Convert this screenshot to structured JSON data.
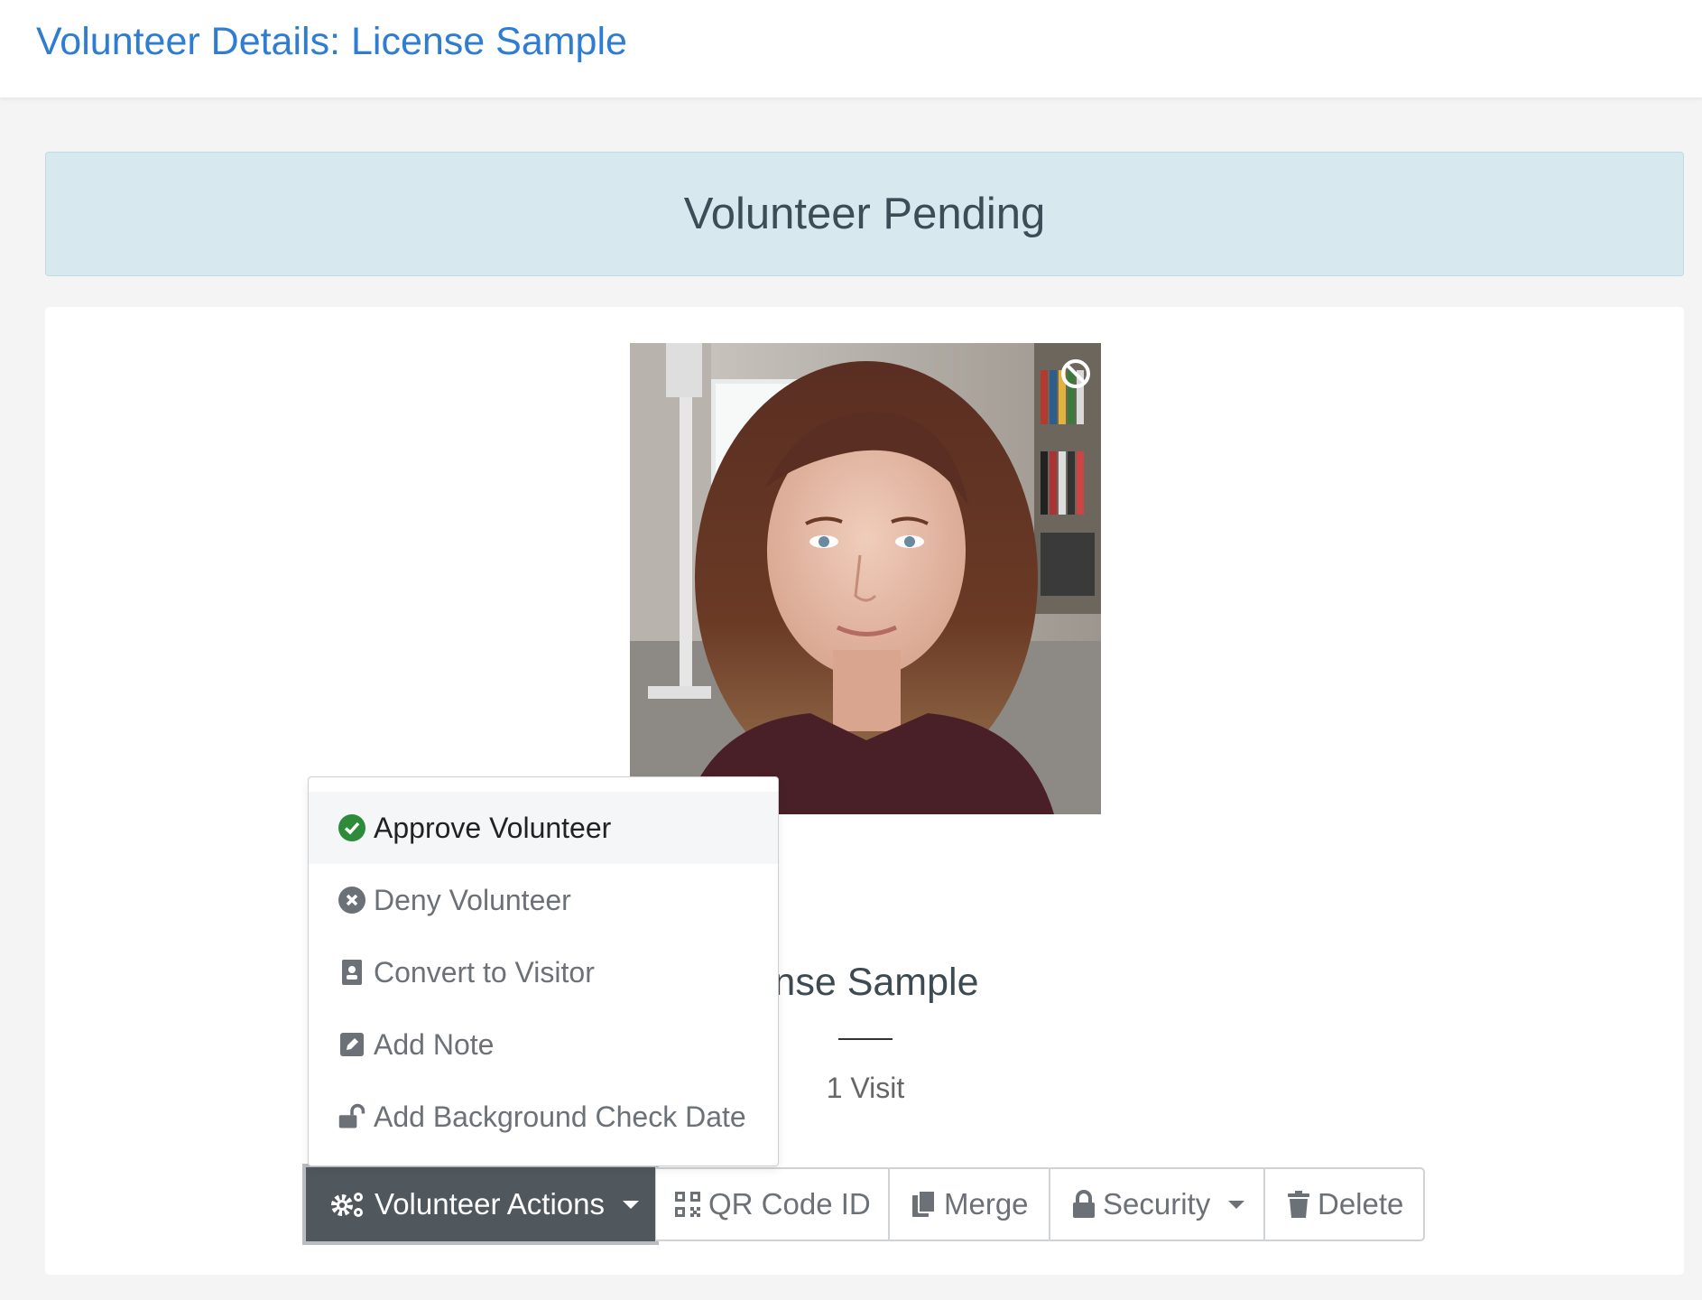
{
  "header": {
    "title": "Volunteer Details: License Sample"
  },
  "status": {
    "text": "Volunteer Pending",
    "bg_color": "#d7e9ef"
  },
  "profile": {
    "photo_icon": "no-photo-icon",
    "name": "License Sample",
    "name_visible": "ense Sample",
    "visits": "1 Visit"
  },
  "menu": {
    "items": [
      {
        "label": "Approve Volunteer",
        "icon": "check-circle-icon",
        "color": "#2e8b3a"
      },
      {
        "label": "Deny Volunteer",
        "icon": "x-circle-icon"
      },
      {
        "label": "Convert to Visitor",
        "icon": "id-badge-icon"
      },
      {
        "label": "Add Note",
        "icon": "edit-icon"
      },
      {
        "label": "Add Background Check Date",
        "icon": "unlock-icon"
      }
    ]
  },
  "toolbar": {
    "actions_label": "Volunteer Actions",
    "qr_label": "QR Code ID",
    "merge_label": "Merge",
    "security_label": "Security",
    "delete_label": "Delete"
  }
}
